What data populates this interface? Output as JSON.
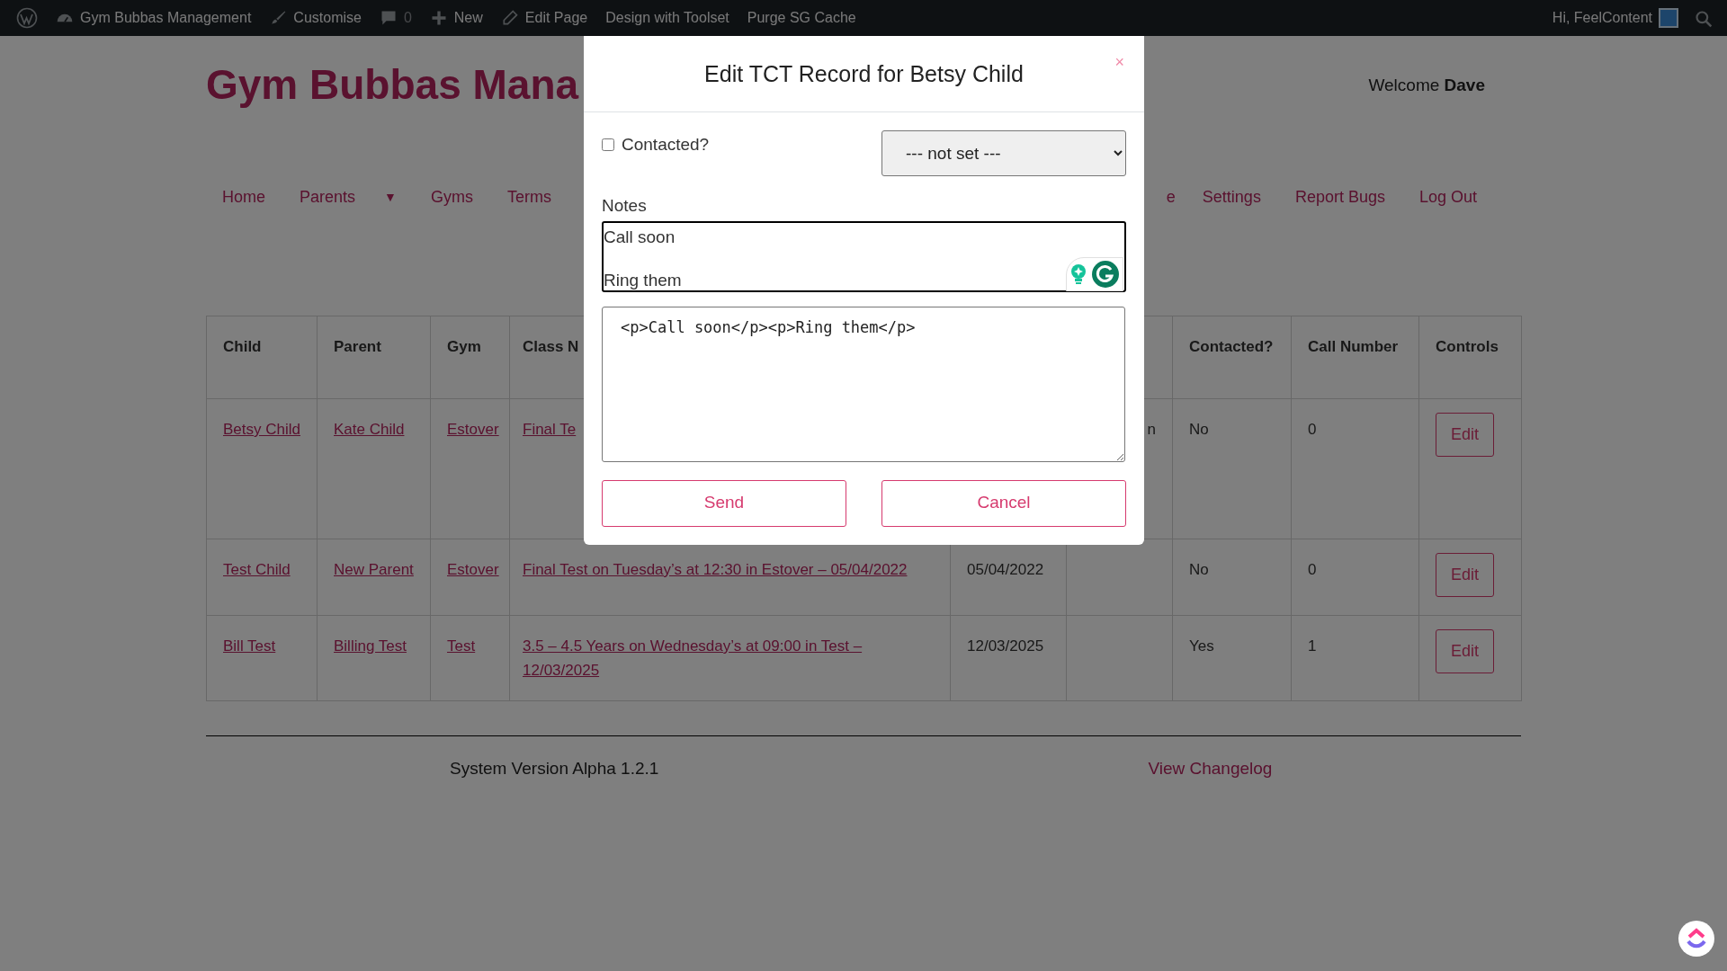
{
  "admin_bar": {
    "left": [
      {
        "kind": "wordpress"
      },
      {
        "kind": "dashboard",
        "label": "Gym Bubbas Management"
      },
      {
        "kind": "brush",
        "label": "Customise"
      },
      {
        "kind": "comment",
        "label": "0"
      },
      {
        "kind": "plus",
        "label": "New"
      },
      {
        "kind": "pencil",
        "label": "Edit Page"
      },
      {
        "label": "Design with Toolset"
      },
      {
        "label": "Purge SG Cache"
      }
    ],
    "greeting": "Hi, FeelContent"
  },
  "site": {
    "title": "Gym Bubbas Mana",
    "welcome": "Welcome **Dave**"
  },
  "nav": {
    "left": [
      {
        "kind": "link",
        "label": "Home"
      },
      {
        "kind": "link",
        "label": "Parents"
      },
      {
        "kind": "caret",
        "label": "▼"
      },
      {
        "kind": "link",
        "label": "Gyms"
      },
      {
        "kind": "link",
        "label": "Terms"
      }
    ],
    "right": [
      {
        "kind": "link",
        "label": "e"
      },
      {
        "kind": "link",
        "label": "Settings"
      },
      {
        "kind": "link",
        "label": "Report Bugs"
      },
      {
        "kind": "link",
        "label": "Log Out"
      }
    ]
  },
  "table": {
    "headers": {
      "child": "Child",
      "parent": "Parent",
      "gym": "Gym",
      "class_name": "Class N",
      "contacted": "Contacted?",
      "call_number": "Call Number",
      "controls": "Controls"
    },
    "rows": [
      {
        "child": "Betsy Child",
        "parent": "Kate Child",
        "gym": "Estover",
        "class_name": "Final Te",
        "column_6": "n",
        "contacted": "No",
        "call_number": "0",
        "control": "Edit"
      },
      {
        "child": "Test Child",
        "parent": "New Parent",
        "gym": "Estover",
        "class_name": "Final Test on Tuesday’s at 12:30 in Estover – 05/04/2022",
        "date": "05/04/2022",
        "contacted": "No",
        "call_number": "0",
        "control": "Edit"
      },
      {
        "child": "Bill Test",
        "parent": "Billing Test",
        "gym": "Test",
        "class_name": "3.5 – 4.5 Years on Wednesday’s at 09:00 in Test – 12/03/2025",
        "date": "12/03/2025",
        "contacted": "Yes",
        "call_number": "1",
        "control": "Edit"
      }
    ]
  },
  "footer": {
    "version": "System Version Alpha 1.2.1",
    "changelog": "View Changelog"
  },
  "modal": {
    "title": "Edit TCT Record for Betsy Child",
    "close": "×",
    "contacted": {
      "label": "Contacted?",
      "checked": false
    },
    "select": {
      "value": "--- not set ---"
    },
    "notes_label": "Notes",
    "editor_lines": [
      "Call soon",
      "Ring them"
    ],
    "source": "<p>Call soon</p><p>Ring them</p>",
    "buttons": [
      "Send",
      "Cancel"
    ]
  }
}
